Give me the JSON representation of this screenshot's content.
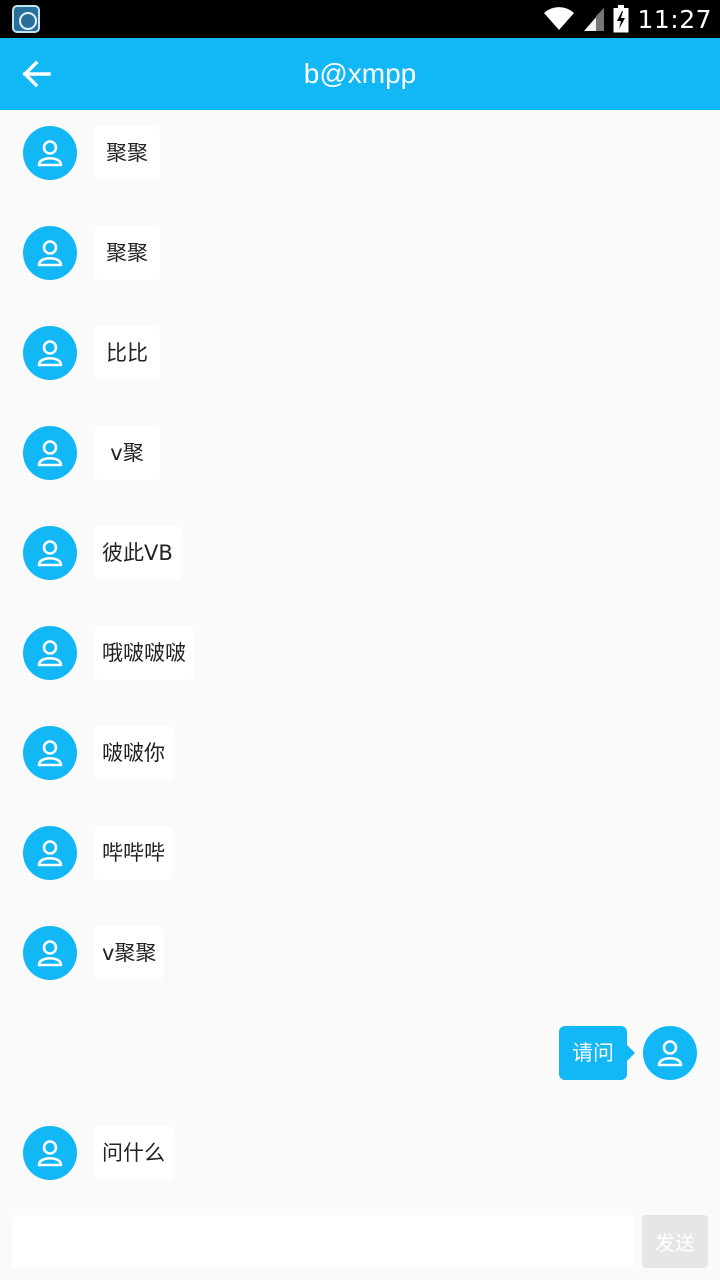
{
  "status_bar": {
    "time": "11:27",
    "icons": [
      "app-notification-icon",
      "wifi-icon",
      "cell-signal-icon",
      "battery-charging-icon"
    ]
  },
  "app_bar": {
    "title": "b@xmpp",
    "back_icon": "arrow-left-icon"
  },
  "colors": {
    "accent": "#12b7f5",
    "background": "#fafafa",
    "incoming_bubble": "#ffffff",
    "send_button_disabled": "#e6e6e6"
  },
  "messages": [
    {
      "side": "left",
      "text": "聚聚"
    },
    {
      "side": "left",
      "text": "聚聚"
    },
    {
      "side": "left",
      "text": "比比"
    },
    {
      "side": "left",
      "text": "v聚"
    },
    {
      "side": "left",
      "text": "彼此VB"
    },
    {
      "side": "left",
      "text": "哦啵啵啵"
    },
    {
      "side": "left",
      "text": "啵啵你"
    },
    {
      "side": "left",
      "text": "哔哔哔"
    },
    {
      "side": "left",
      "text": "v聚聚"
    },
    {
      "side": "right",
      "text": "请问"
    },
    {
      "side": "left",
      "text": "问什么"
    }
  ],
  "input_bar": {
    "value": "",
    "placeholder": "",
    "send_label": "发送"
  }
}
